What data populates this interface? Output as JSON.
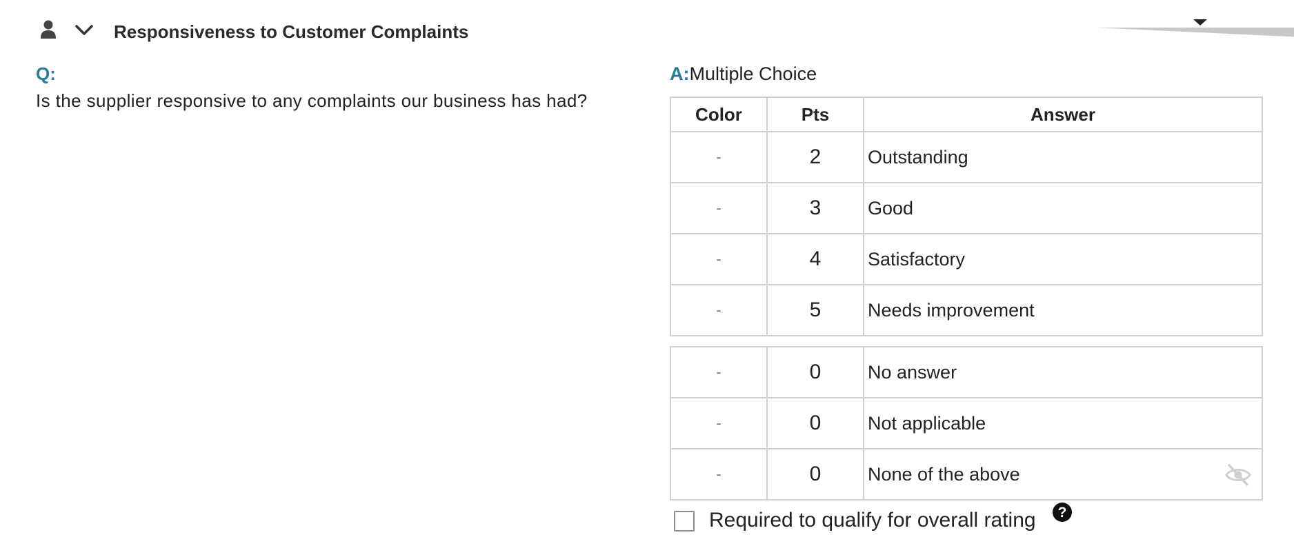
{
  "header": {
    "title": "Responsiveness to Customer Complaints",
    "user_icon": "person-icon",
    "toggle_icon": "chevron-down-icon",
    "menu_icon": "caret-down-icon"
  },
  "question": {
    "label": "Q:",
    "text": "Is the supplier responsive to any complaints our business has had?"
  },
  "answer": {
    "label": "A:",
    "type": "Multiple Choice",
    "columns": [
      "Color",
      "Pts",
      "Answer"
    ],
    "rows": [
      {
        "color": "-",
        "pts": "2",
        "answer": "Outstanding"
      },
      {
        "color": "-",
        "pts": "3",
        "answer": "Good"
      },
      {
        "color": "-",
        "pts": "4",
        "answer": "Satisfactory"
      },
      {
        "color": "-",
        "pts": "5",
        "answer": "Needs improvement"
      }
    ],
    "extra_rows": [
      {
        "color": "-",
        "pts": "0",
        "answer": "No answer"
      },
      {
        "color": "-",
        "pts": "0",
        "answer": "Not applicable"
      },
      {
        "color": "-",
        "pts": "0",
        "answer": "None of the above",
        "icon": "eye-slash-icon"
      }
    ]
  },
  "required": {
    "label": "Required to qualify for overall rating",
    "checked": false,
    "help_icon": "question-circle-icon"
  },
  "colors": {
    "accent": "#2d7b93",
    "border": "#cfcfcf",
    "text": "#222222"
  }
}
